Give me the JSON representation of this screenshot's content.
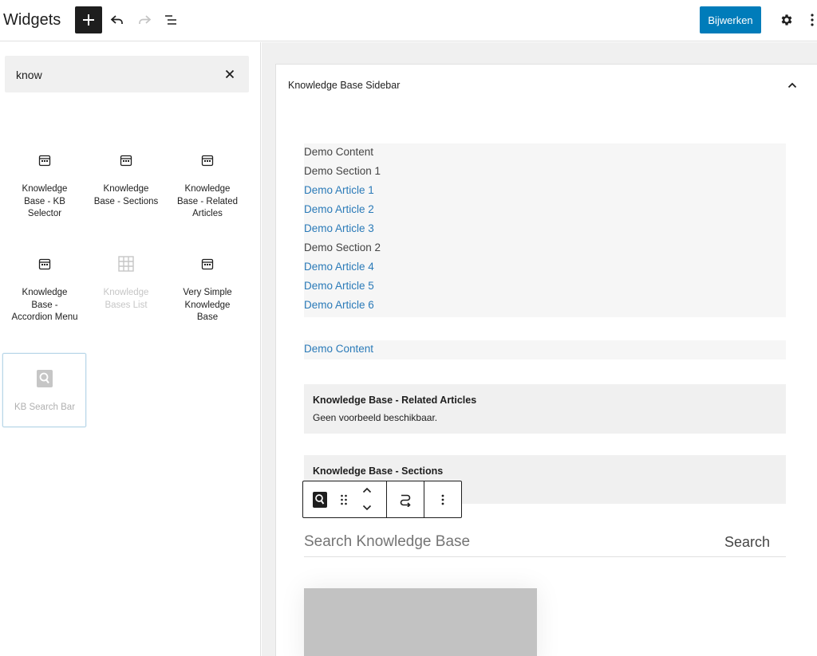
{
  "header": {
    "title": "Widgets",
    "update_label": "Bijwerken"
  },
  "inserter": {
    "search": {
      "value": "know"
    },
    "blocks": [
      {
        "label": "Knowledge Base - KB Selector",
        "icon": "calendar-icon",
        "state": "normal"
      },
      {
        "label": "Knowledge Base - Sections",
        "icon": "calendar-icon",
        "state": "normal"
      },
      {
        "label": "Knowledge Base - Related Articles",
        "icon": "calendar-icon",
        "state": "normal"
      },
      {
        "label": "Knowledge Base - Accordion Menu",
        "icon": "calendar-icon",
        "state": "normal"
      },
      {
        "label": "Knowledge Bases List",
        "icon": "grid-icon",
        "state": "disabled"
      },
      {
        "label": "Very Simple Knowledge Base",
        "icon": "calendar-icon",
        "state": "normal"
      },
      {
        "label": "KB Search Bar",
        "icon": "kb-search-icon",
        "state": "selected"
      }
    ]
  },
  "widget_area": {
    "title": "Knowledge Base Sidebar",
    "list": [
      {
        "text": "Demo Content",
        "type": "plain"
      },
      {
        "text": "Demo Section 1",
        "type": "plain"
      },
      {
        "text": "Demo Article 1",
        "type": "link"
      },
      {
        "text": "Demo Article 2",
        "type": "link"
      },
      {
        "text": "Demo Article 3",
        "type": "link"
      },
      {
        "text": "Demo Section 2",
        "type": "plain"
      },
      {
        "text": "Demo Article 4",
        "type": "link"
      },
      {
        "text": "Demo Article 5",
        "type": "link"
      },
      {
        "text": "Demo Article 6",
        "type": "link"
      }
    ],
    "demo_content_link": "Demo Content",
    "related_articles": {
      "title": "Knowledge Base - Related Articles",
      "text": "Geen voorbeeld beschikbaar."
    },
    "sections": {
      "title": "Knowledge Base - Sections"
    },
    "kb_search": {
      "placeholder": "Search Knowledge Base",
      "button": "Search"
    }
  },
  "colors": {
    "accent": "#007cba",
    "link": "#2a7ab8",
    "dark": "#1e1e1e"
  }
}
